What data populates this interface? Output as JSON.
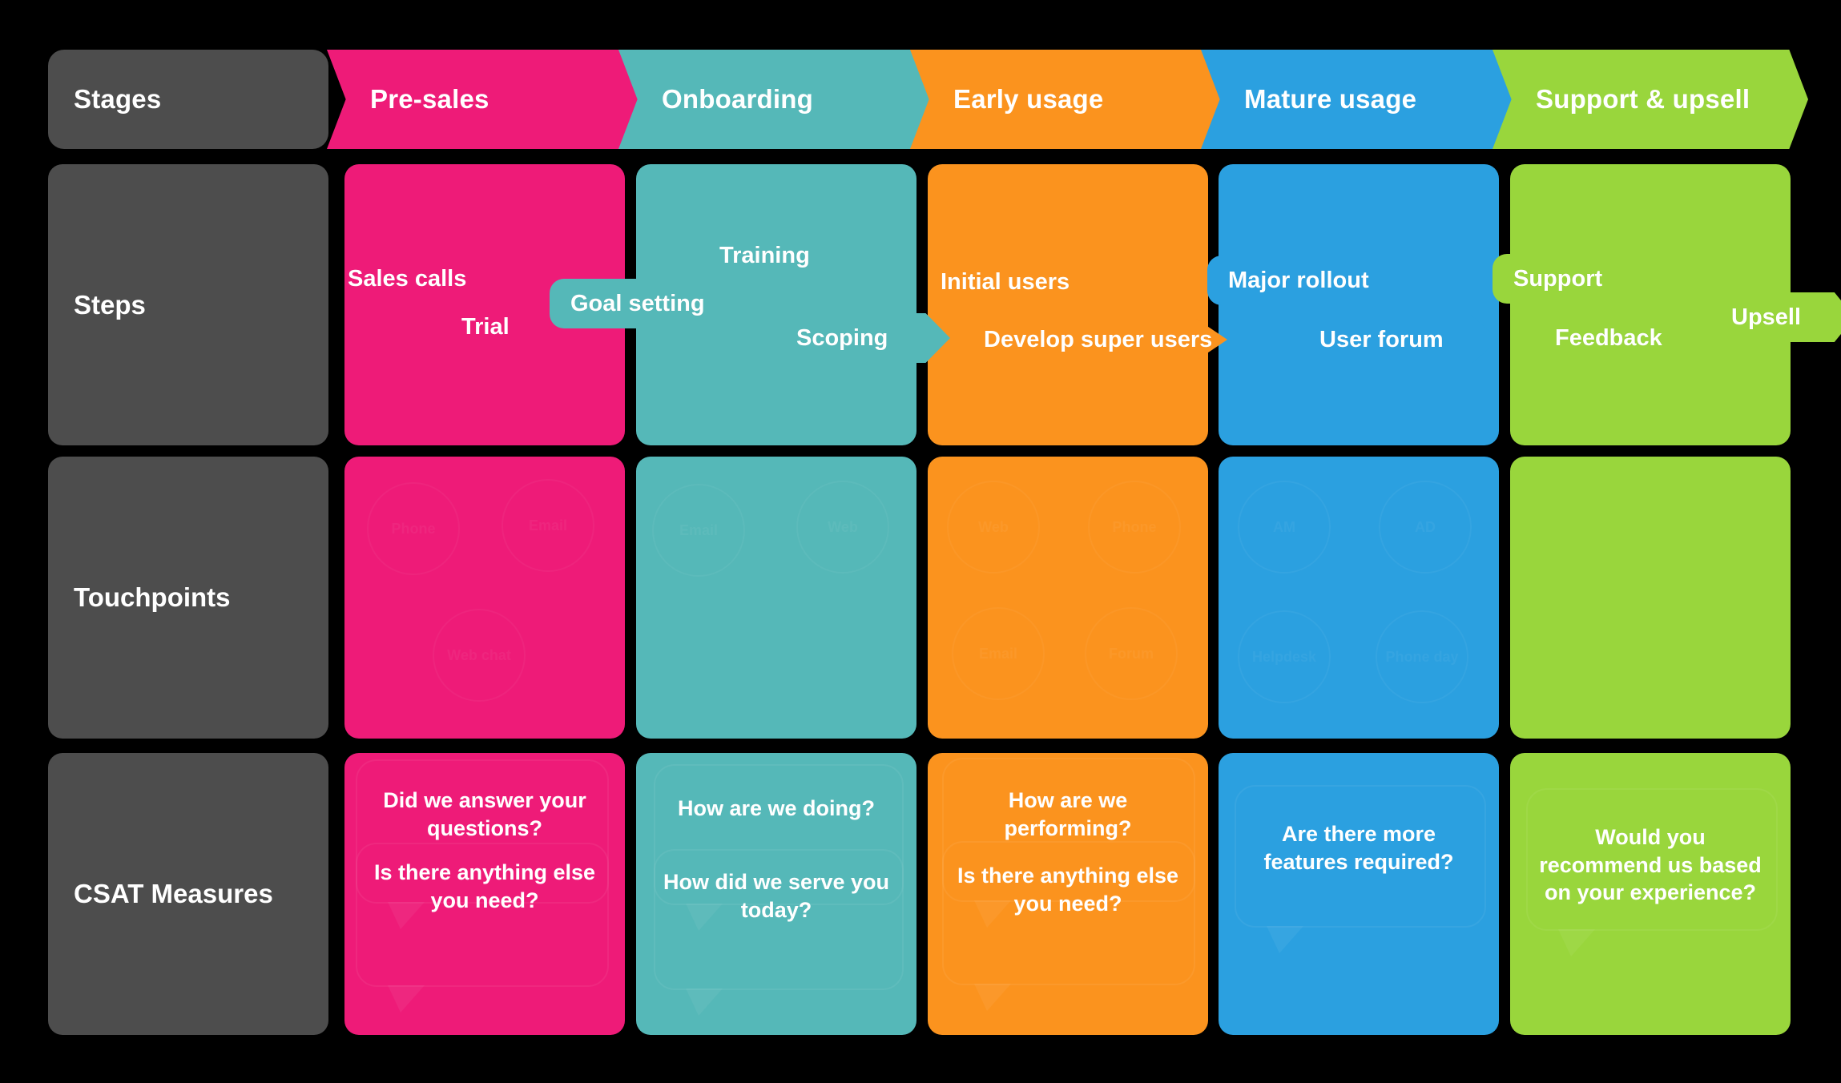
{
  "palette": {
    "background": "#000000",
    "label_gray": "#4d4d4d",
    "pink": "#ee1b78",
    "teal": "#55b8b8",
    "orange": "#fb931e",
    "blue": "#2ba0e0",
    "green": "#99d63c",
    "text_white": "#ffffff"
  },
  "header": {
    "row_label": "Stages",
    "stages": [
      {
        "label": "Pre-sales",
        "color": "#ee1b78"
      },
      {
        "label": "Onboarding",
        "color": "#55b8b8"
      },
      {
        "label": "Early usage",
        "color": "#fb931e"
      },
      {
        "label": "Mature usage",
        "color": "#2ba0e0"
      },
      {
        "label": "Support & upsell",
        "color": "#99d63c"
      }
    ]
  },
  "rows": [
    {
      "label": "Steps",
      "cells": [
        {
          "color": "#ee1b78",
          "chips": [
            {
              "text": "Sales calls",
              "shape": "plain"
            },
            {
              "text": "Trial",
              "shape": "plain"
            }
          ]
        },
        {
          "color": "#55b8b8",
          "chips": [
            {
              "text": "Goal setting",
              "shape": "pill"
            },
            {
              "text": "Training",
              "shape": "plain"
            },
            {
              "text": "Scoping",
              "shape": "arrow"
            }
          ]
        },
        {
          "color": "#fb931e",
          "chips": [
            {
              "text": "Initial users",
              "shape": "plain"
            },
            {
              "text": "Develop super users",
              "shape": "arrow"
            }
          ]
        },
        {
          "color": "#2ba0e0",
          "chips": [
            {
              "text": "Major rollout",
              "shape": "pill"
            },
            {
              "text": "User forum",
              "shape": "arrow"
            }
          ]
        },
        {
          "color": "#99d63c",
          "chips": [
            {
              "text": "Support",
              "shape": "pill"
            },
            {
              "text": "Feedback",
              "shape": "plain"
            },
            {
              "text": "Upsell",
              "shape": "arrow"
            }
          ]
        }
      ]
    },
    {
      "label": "Touchpoints",
      "cells": [
        {
          "color": "#ee1b78",
          "badges": [
            "Phone",
            "Email",
            "Web chat"
          ]
        },
        {
          "color": "#55b8b8",
          "badges": [
            "Email",
            "Web"
          ]
        },
        {
          "color": "#fb931e",
          "badges": [
            "Web",
            "Phone",
            "Email",
            "Forum"
          ]
        },
        {
          "color": "#2ba0e0",
          "badges": [
            "AM",
            "AD",
            "Helpdesk",
            "Phone day"
          ]
        },
        {
          "color": "#99d63c",
          "badges": []
        }
      ]
    },
    {
      "label": "CSAT Measures",
      "cells": [
        {
          "color": "#ee1b78",
          "questions": [
            "Did we answer your questions?",
            "Is there anything else you need?"
          ]
        },
        {
          "color": "#55b8b8",
          "questions": [
            "How are we doing?",
            "How did we serve you today?"
          ]
        },
        {
          "color": "#fb931e",
          "questions": [
            "How are we performing?",
            "Is there anything else you need?"
          ]
        },
        {
          "color": "#2ba0e0",
          "questions": [
            "Are there more features required?"
          ]
        },
        {
          "color": "#99d63c",
          "questions": [
            "Would you recommend us based on your experience?"
          ]
        }
      ]
    }
  ]
}
